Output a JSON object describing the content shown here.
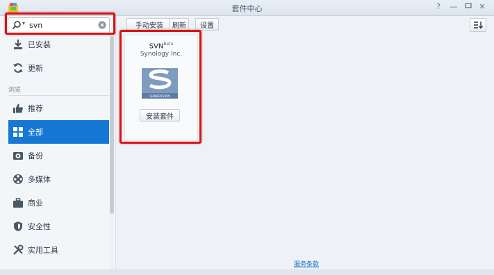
{
  "window": {
    "title": "套件中心"
  },
  "search": {
    "value": "svn",
    "placeholder": ""
  },
  "sidebar": {
    "top_items": [
      {
        "label": "已安装",
        "icon": "download-icon"
      },
      {
        "label": "更新",
        "icon": "refresh-icon"
      }
    ],
    "section_label": "浏览",
    "categories": [
      {
        "label": "推荐",
        "icon": "thumbs-up-icon"
      },
      {
        "label": "全部",
        "icon": "grid-icon",
        "active": true
      },
      {
        "label": "备份",
        "icon": "backup-icon"
      },
      {
        "label": "多媒体",
        "icon": "film-reel-icon"
      },
      {
        "label": "商业",
        "icon": "briefcase-icon"
      },
      {
        "label": "安全性",
        "icon": "shield-icon"
      },
      {
        "label": "实用工具",
        "icon": "tools-icon"
      }
    ]
  },
  "toolbar": {
    "manual_install": "手动安装",
    "refresh": "刷新",
    "settings": "设置"
  },
  "package": {
    "name": "SVN",
    "badge": "Beta",
    "vendor": "Synology Inc.",
    "logo_text": "SUBVERSION",
    "install_label": "安装套件"
  },
  "footer": {
    "terms_link": "服务条款"
  },
  "colors": {
    "accent": "#1478d4",
    "highlight": "#e01010"
  }
}
